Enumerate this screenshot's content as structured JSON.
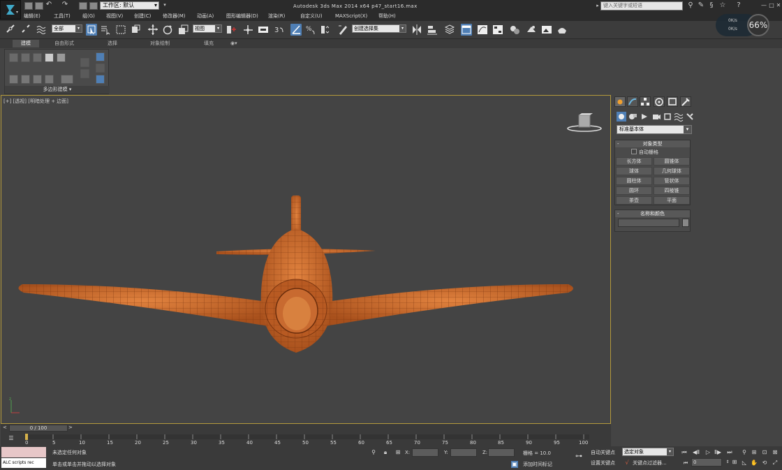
{
  "window": {
    "title": "Autodesk 3ds Max  2014 x64     p47_start16.max",
    "workspace": "工作区: 默认",
    "search_placeholder": "键入关键字或短语"
  },
  "menu": [
    "编辑(E)",
    "工具(T)",
    "组(G)",
    "视图(V)",
    "创建(C)",
    "修改器(M)",
    "动画(A)",
    "图形编辑器(D)",
    "渲染(R)",
    "自定义(U)",
    "MAXScript(X)",
    "帮助(H)"
  ],
  "hud": {
    "top": "0K/s",
    "bottom": "0K/s",
    "gauge": "66%"
  },
  "toolbar": {
    "selection_filter": "全部",
    "reference_coord": "视图",
    "named_selection": "创建选择集"
  },
  "ribbon": {
    "tabs": [
      "建模",
      "自由形式",
      "选择",
      "对象绘制",
      "填充"
    ],
    "panel_label": "多边形建模 ▾"
  },
  "viewport": {
    "label": "[+] [透视] [明暗处理 + 边面]",
    "model_color": "#c8662a",
    "wire_color": "#7a3510",
    "border_color": "#b59a3c"
  },
  "command_panel": {
    "primitive_type": "标准基本体",
    "object_type_header": "对象类型",
    "autogrid_label": "自动栅格",
    "object_buttons": [
      "长方体",
      "圆锥体",
      "球体",
      "几何球体",
      "圆柱体",
      "管状体",
      "圆环",
      "四棱锥",
      "茶壶",
      "平面"
    ],
    "name_color_header": "名称和颜色"
  },
  "timeline": {
    "slider_label": "0 / 100",
    "ticks": [
      "0",
      "5",
      "10",
      "15",
      "20",
      "25",
      "30",
      "35",
      "40",
      "45",
      "50",
      "55",
      "60",
      "65",
      "70",
      "75",
      "80",
      "85",
      "90",
      "95",
      "100"
    ]
  },
  "status": {
    "maxscript_label": "ALC scripts rec",
    "selection_status": "未选定任何对象",
    "prompt": "单击或单击并拖动以选择对象",
    "x_label": "X:",
    "y_label": "Y:",
    "z_label": "Z:",
    "grid": "栅格 = 10.0",
    "add_time_tag": "添加时间标记",
    "auto_key": "自动关键点",
    "set_key": "设置关键点",
    "selected_dd": "选定对象",
    "key_filters": "关键点过滤器...",
    "frame": "0"
  }
}
